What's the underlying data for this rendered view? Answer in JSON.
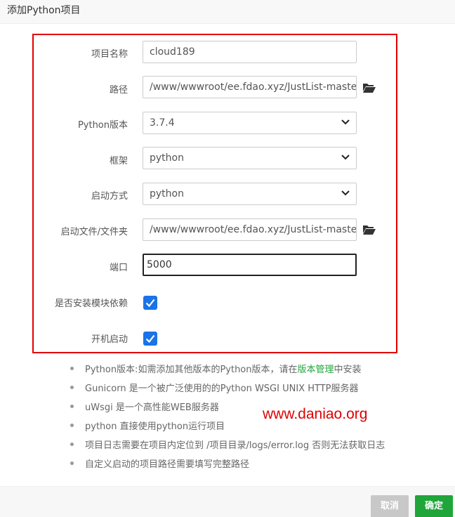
{
  "dialog": {
    "title": "添加Python项目"
  },
  "form": {
    "project_name": {
      "label": "项目名称",
      "value": "cloud189"
    },
    "path": {
      "label": "路径",
      "value": "/www/wwwroot/ee.fdao.xyz/JustList-master/"
    },
    "python_version": {
      "label": "Python版本",
      "value": "3.7.4"
    },
    "framework": {
      "label": "框架",
      "value": "python"
    },
    "start_mode": {
      "label": "启动方式",
      "value": "python"
    },
    "start_file": {
      "label": "启动文件/文件夹",
      "value": "/www/wwwroot/ee.fdao.xyz/JustList-master/m"
    },
    "port": {
      "label": "端口",
      "value": "5000"
    },
    "install_deps": {
      "label": "是否安装模块依赖",
      "checked": true
    },
    "autostart": {
      "label": "开机启动",
      "checked": true
    }
  },
  "tips": [
    {
      "before": "Python版本:如需添加其他版本的Python版本，请在",
      "link": "版本管理",
      "after": "中安装"
    },
    {
      "before": "Gunicorn 是一个被广泛使用的的Python WSGI UNIX HTTP服务器",
      "link": "",
      "after": ""
    },
    {
      "before": "uWsgi 是一个高性能WEB服务器",
      "link": "",
      "after": ""
    },
    {
      "before": "python 直接使用python运行项目",
      "link": "",
      "after": ""
    },
    {
      "before": "项目日志需要在项目内定位到 /项目目录/logs/error.log 否则无法获取日志",
      "link": "",
      "after": ""
    },
    {
      "before": "自定义启动的项目路径需要填写完整路径",
      "link": "",
      "after": ""
    }
  ],
  "watermark": "www.daniao.org",
  "buttons": {
    "cancel": "取消",
    "confirm": "确定"
  },
  "colors": {
    "accent": "#20a53a",
    "checkbox": "#1a73e8",
    "highlight_frame": "#e00000"
  }
}
